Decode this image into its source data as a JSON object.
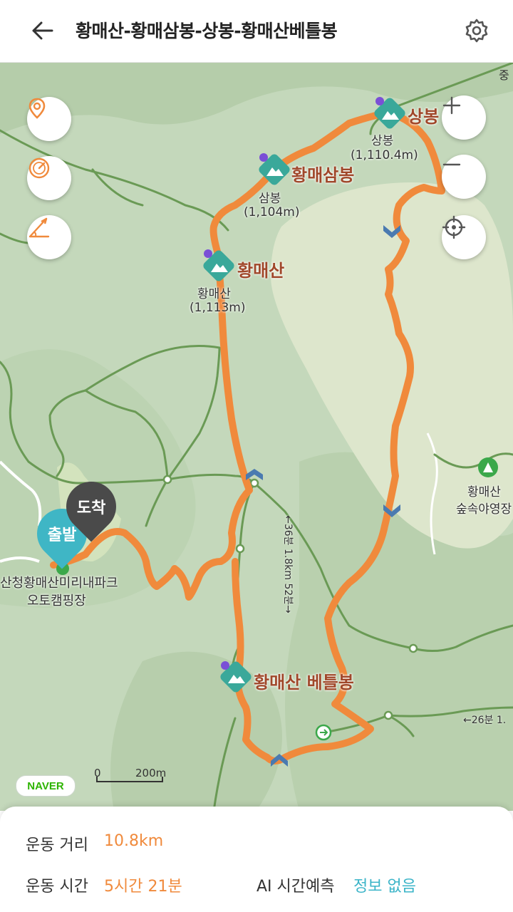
{
  "header": {
    "title": "황매산-황매삼봉-상봉-황매산베틀봉",
    "back_icon": "back-arrow-icon",
    "settings_icon": "gear-icon"
  },
  "map": {
    "labels": {
      "sangbong_title": "상봉",
      "sangbong_name": "상봉",
      "sangbong_elev": "(1,110.4m)",
      "samjae_title": "황매삼봉",
      "samjae_name": "삼봉",
      "samjae_elev": "(1,104m)",
      "hwangmae_title": "황매산",
      "hwangmae_name": "황매산",
      "hwangmae_elev": "(1,113m)",
      "beteul_title": "황매산 베틀봉",
      "camp_name": "황매산",
      "camp_name2": "숲속야영장",
      "autocamp1": "산청황매산미리내파크",
      "autocamp2": "오토캠핑장",
      "trail_time1": "←36분 1.8km 52분→",
      "trail_time2": "←26분 1.",
      "edge_label": "중"
    },
    "start_label": "출발",
    "end_label": "도착",
    "brand": "NAVER",
    "scale_zero": "0",
    "scale_label": "200m",
    "buttons": {
      "location": "location-pin-icon",
      "speed": "speedometer-icon",
      "slope": "slope-icon",
      "zoom_in": "plus-icon",
      "zoom_out": "minus-icon",
      "recenter": "crosshair-icon"
    },
    "colors": {
      "route": "#f08a3c",
      "map_bg": "#c4d8bb",
      "trail": "#6a9a55",
      "peak_icon": "#3aa89a"
    }
  },
  "stats": {
    "distance_label": "운동 거리",
    "distance_value": "10.8km",
    "time_label": "운동 시간",
    "time_value": "5시간 21분",
    "ai_label": "AI 시간예측",
    "ai_value": "정보 없음"
  }
}
